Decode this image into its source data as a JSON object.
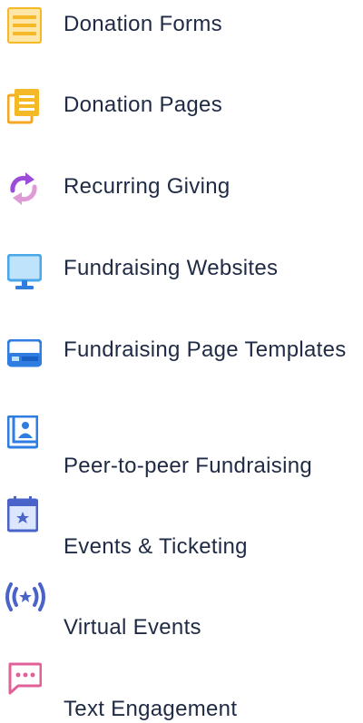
{
  "menu": {
    "items": [
      {
        "label": "Donation Forms",
        "icon": "form-icon",
        "color": "#f5b826"
      },
      {
        "label": "Donation Pages",
        "icon": "pages-icon",
        "color": "#f5b826"
      },
      {
        "label": "Recurring Giving",
        "icon": "recurring-icon",
        "color": "#9b4dd9"
      },
      {
        "label": "Fundraising Websites",
        "icon": "monitor-icon",
        "color": "#4aa8e8"
      },
      {
        "label": "Fundraising Page Templates",
        "icon": "template-icon",
        "color": "#2f7de1"
      },
      {
        "label": "Peer-to-peer Fundraising",
        "icon": "person-icon",
        "color": "#2f7de1"
      },
      {
        "label": "Events & Ticketing",
        "icon": "calendar-icon",
        "color": "#4a63c9"
      },
      {
        "label": "Virtual Events",
        "icon": "broadcast-icon",
        "color": "#4a63c9"
      },
      {
        "label": "Text Engagement",
        "icon": "chat-icon",
        "color": "#e0609a"
      }
    ]
  }
}
